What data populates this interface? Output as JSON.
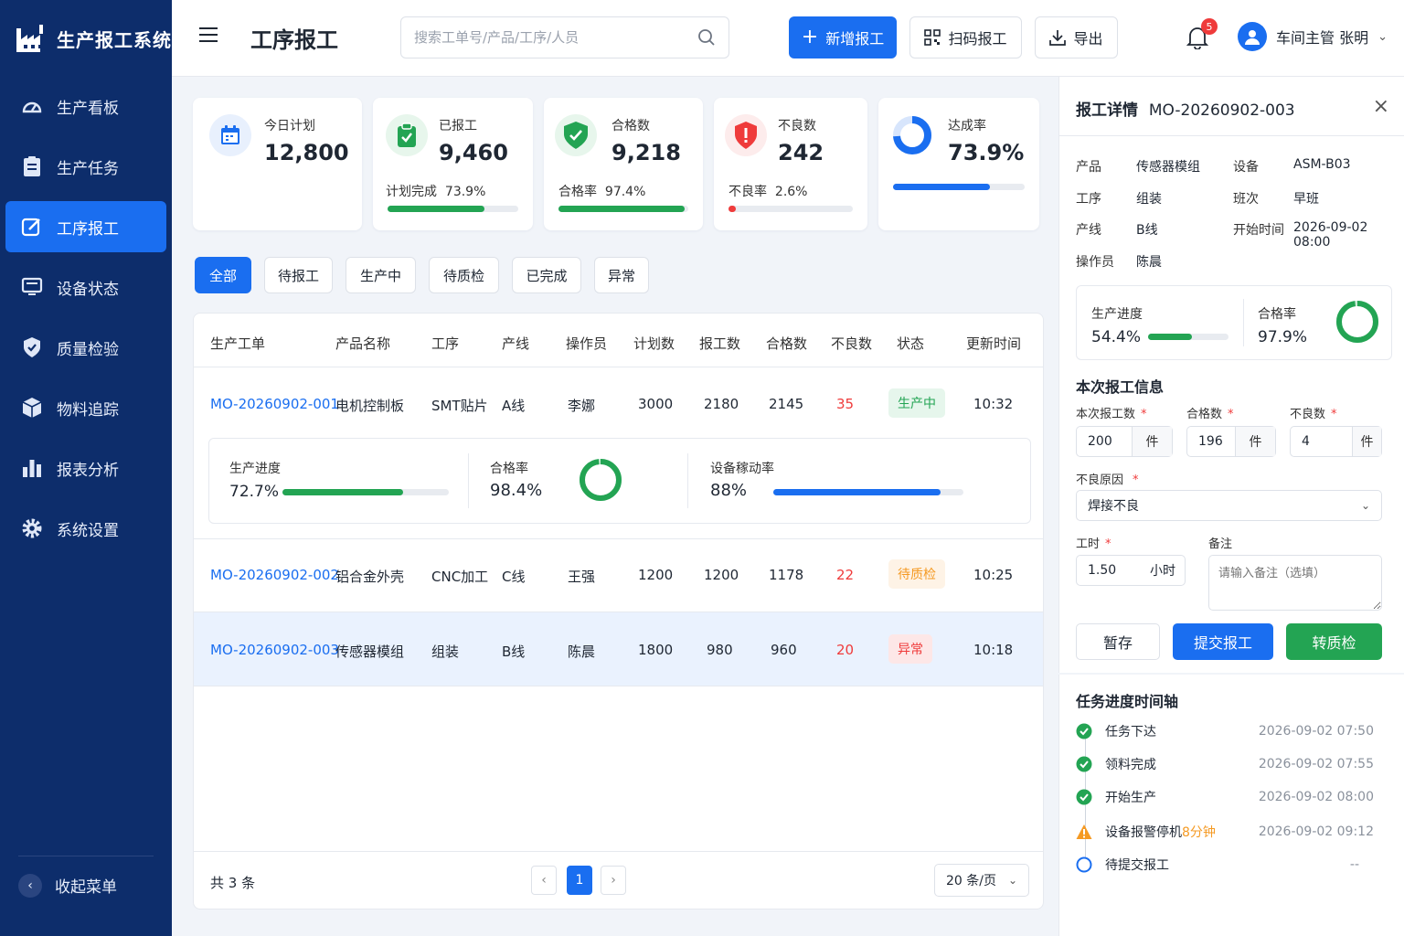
{
  "brand": {
    "title": "生产报工系统"
  },
  "sidebar": {
    "items": [
      {
        "label": "生产看板",
        "icon": "dashboard-icon"
      },
      {
        "label": "生产任务",
        "icon": "task-icon"
      },
      {
        "label": "工序报工",
        "icon": "edit-icon",
        "active": true
      },
      {
        "label": "设备状态",
        "icon": "monitor-icon"
      },
      {
        "label": "质量检验",
        "icon": "shield-icon"
      },
      {
        "label": "物料追踪",
        "icon": "box-icon"
      },
      {
        "label": "报表分析",
        "icon": "bar-chart-icon"
      },
      {
        "label": "系统设置",
        "icon": "gear-icon"
      }
    ],
    "collapse_label": "收起菜单"
  },
  "header": {
    "title": "工序报工",
    "search_placeholder": "搜索工单号/产品/工序/人员",
    "new_label": "新增报工",
    "scan_label": "扫码报工",
    "export_label": "导出",
    "notif_count": "5",
    "user_name": "车间主管 张明"
  },
  "stats": {
    "plan": {
      "label": "今日计划",
      "value": "12,800"
    },
    "reported": {
      "label": "已报工",
      "value": "9,460",
      "sub_label": "计划完成",
      "sub_value": "73.9%",
      "progress": 0.739
    },
    "qualified": {
      "label": "合格数",
      "value": "9,218",
      "sub_label": "合格率",
      "sub_value": "97.4%",
      "progress": 0.974
    },
    "defect": {
      "label": "不良数",
      "value": "242",
      "sub_label": "不良率",
      "sub_value": "2.6%",
      "progress": 0.026
    },
    "rate": {
      "label": "达成率",
      "value": "73.9%",
      "progress": 0.739
    }
  },
  "filters": [
    "全部",
    "待报工",
    "生产中",
    "待质检",
    "已完成",
    "异常"
  ],
  "table": {
    "headers": [
      "生产工单",
      "产品名称",
      "工序",
      "产线",
      "操作员",
      "计划数",
      "报工数",
      "合格数",
      "不良数",
      "状态",
      "更新时间"
    ],
    "rows": [
      {
        "order": "MO-20260902-001",
        "product": "电机控制板",
        "process": "SMT贴片",
        "line": "A线",
        "operator": "李娜",
        "plan": "3000",
        "reported": "2180",
        "qualified": "2145",
        "defect": "35",
        "status": "生产中",
        "time": "10:32"
      },
      {
        "order": "MO-20260902-002",
        "product": "铝合金外壳",
        "process": "CNC加工",
        "line": "C线",
        "operator": "王强",
        "plan": "1200",
        "reported": "1200",
        "qualified": "1178",
        "defect": "22",
        "status": "待质检",
        "time": "10:25"
      },
      {
        "order": "MO-20260902-003",
        "product": "传感器模组",
        "process": "组装",
        "line": "B线",
        "operator": "陈晨",
        "plan": "1800",
        "reported": "980",
        "qualified": "960",
        "defect": "20",
        "status": "异常",
        "time": "10:18"
      }
    ],
    "expand": {
      "progress_label": "生产进度",
      "progress_value": "72.7%",
      "progress": 0.727,
      "pass_label": "合格率",
      "pass_value": "98.4%",
      "pass": 0.984,
      "oee_label": "设备稼动率",
      "oee_value": "88%",
      "oee": 0.88
    },
    "total": "共 3 条",
    "page": "1",
    "page_size": "20 条/页"
  },
  "detail": {
    "title": "报工详情",
    "order": "MO-20260902-003",
    "fields": {
      "product_label": "产品",
      "product": "传感器模组",
      "device_label": "设备",
      "device": "ASM-B03",
      "process_label": "工序",
      "process": "组装",
      "shift_label": "班次",
      "shift": "早班",
      "line_label": "产线",
      "line": "B线",
      "start_label": "开始时间",
      "start": "2026-09-02 08:00",
      "operator_label": "操作员",
      "operator": "陈晨"
    },
    "progress_label": "生产进度",
    "progress_value": "54.4%",
    "progress": 0.544,
    "pass_label": "合格率",
    "pass_value": "97.9%",
    "pass": 0.979,
    "form": {
      "section": "本次报工信息",
      "qty_label": "本次报工数",
      "qty": "200",
      "qty_unit": "件",
      "ok_label": "合格数",
      "ok": "196",
      "ok_unit": "件",
      "ng_label": "不良数",
      "ng": "4",
      "ng_unit": "件",
      "reason_label": "不良原因",
      "reason": "焊接不良",
      "hours_label": "工时",
      "hours": "1.50",
      "hours_unit": "小时",
      "remark_label": "备注",
      "remark_placeholder": "请输入备注（选填）",
      "save_label": "暂存",
      "submit_label": "提交报工",
      "qc_label": "转质检"
    }
  },
  "timeline": {
    "title": "任务进度时间轴",
    "items": [
      {
        "label": "任务下达",
        "time": "2026-09-02 07:50",
        "state": "done"
      },
      {
        "label": "领料完成",
        "time": "2026-09-02 07:55",
        "state": "done"
      },
      {
        "label": "开始生产",
        "time": "2026-09-02 08:00",
        "state": "done"
      },
      {
        "label": "设备报警停机",
        "extra": "8分钟",
        "time": "2026-09-02 09:12",
        "state": "warn"
      },
      {
        "label": "待提交报工",
        "time": "--",
        "state": "pending"
      }
    ]
  },
  "colors": {
    "primary": "#1a6ef0",
    "sidebar": "#0d2d6b",
    "green": "#23a453",
    "red": "#ef3b3b",
    "orange": "#f59a23"
  }
}
